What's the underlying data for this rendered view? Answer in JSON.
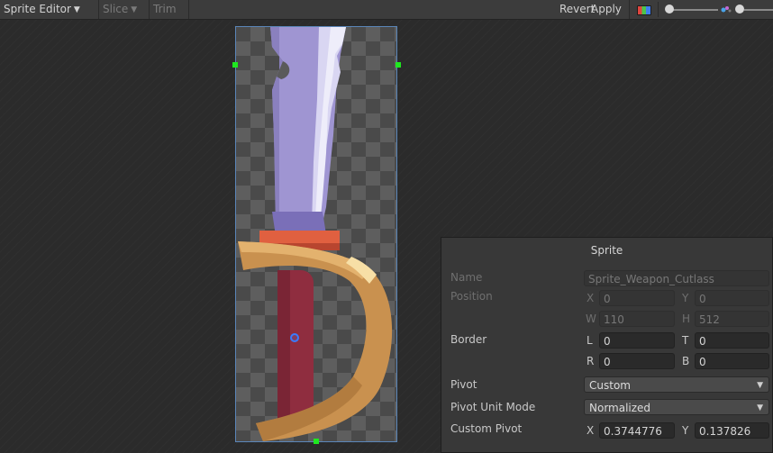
{
  "toolbar": {
    "sprite_editor": "Sprite Editor",
    "slice": "Slice",
    "trim": "Trim",
    "revert": "Revert",
    "apply": "Apply",
    "icons": [
      "chevron-down-icon",
      "rgb-channels-icon",
      "zoom-slider",
      "mipmap-icon",
      "mip-level-slider"
    ]
  },
  "inspector": {
    "title": "Sprite",
    "name_label": "Name",
    "name_value": "Sprite_Weapon_Cutlass",
    "position_label": "Position",
    "pos_x_axis": "X",
    "pos_x": "0",
    "pos_y_axis": "Y",
    "pos_y": "0",
    "pos_w_axis": "W",
    "pos_w": "110",
    "pos_h_axis": "H",
    "pos_h": "512",
    "border_label": "Border",
    "border_l_axis": "L",
    "border_l": "0",
    "border_t_axis": "T",
    "border_t": "0",
    "border_r_axis": "R",
    "border_r": "0",
    "border_b_axis": "B",
    "border_b": "0",
    "pivot_label": "Pivot",
    "pivot_value": "Custom",
    "pivot_unit_label": "Pivot Unit Mode",
    "pivot_unit_value": "Normalized",
    "custom_pivot_label": "Custom Pivot",
    "custom_x_axis": "X",
    "custom_x": "0.3744776",
    "custom_y_axis": "Y",
    "custom_y": "0.137826"
  },
  "colors": {
    "handle": "#1fe81f",
    "selection_outline": "#5b86b9",
    "pivot": "#3a7bff"
  }
}
